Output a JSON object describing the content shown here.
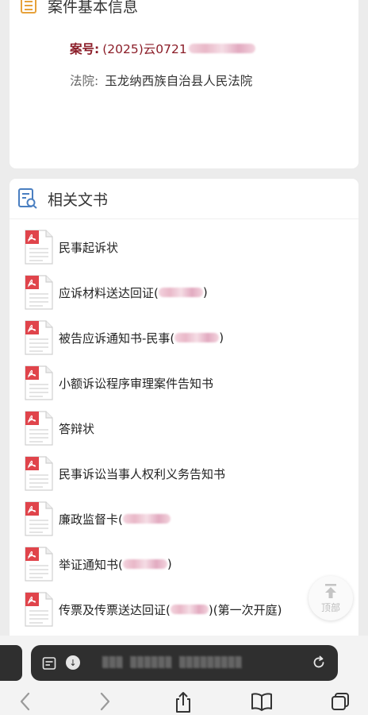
{
  "case_info": {
    "title": "案件基本信息",
    "case_no_label": "案号:",
    "case_no_value": "(2025)云0721",
    "court_label": "法院:",
    "court_value": "玉龙纳西族自治县人民法院"
  },
  "documents": {
    "title": "相关文书",
    "items": [
      {
        "label": "民事起诉状",
        "suffix": ""
      },
      {
        "label": "应诉材料送达回证(",
        "suffix": ")"
      },
      {
        "label": "被告应诉通知书-民事(",
        "suffix": ")"
      },
      {
        "label": "小额诉讼程序审理案件告知书",
        "suffix": ""
      },
      {
        "label": "答辩状",
        "suffix": ""
      },
      {
        "label": "民事诉讼当事人权利义务告知书",
        "suffix": ""
      },
      {
        "label": "廉政监督卡(",
        "suffix": ""
      },
      {
        "label": "举证通知书(",
        "suffix": ")"
      },
      {
        "label": "传票及传票送达回证(",
        "suffix": ")(第一次开庭)"
      }
    ]
  },
  "back_to_top": {
    "label": "顶部"
  },
  "browser": {
    "url": "▒▒▒ ▒▒▒▒▒▒ ▒▒▒▒▒▒▒▒▒"
  },
  "colors": {
    "accent": "#8b1d28",
    "pdf_red": "#e0444b",
    "header_icon_orange": "#e7a23b",
    "docs_icon_blue": "#4a7fc1"
  }
}
